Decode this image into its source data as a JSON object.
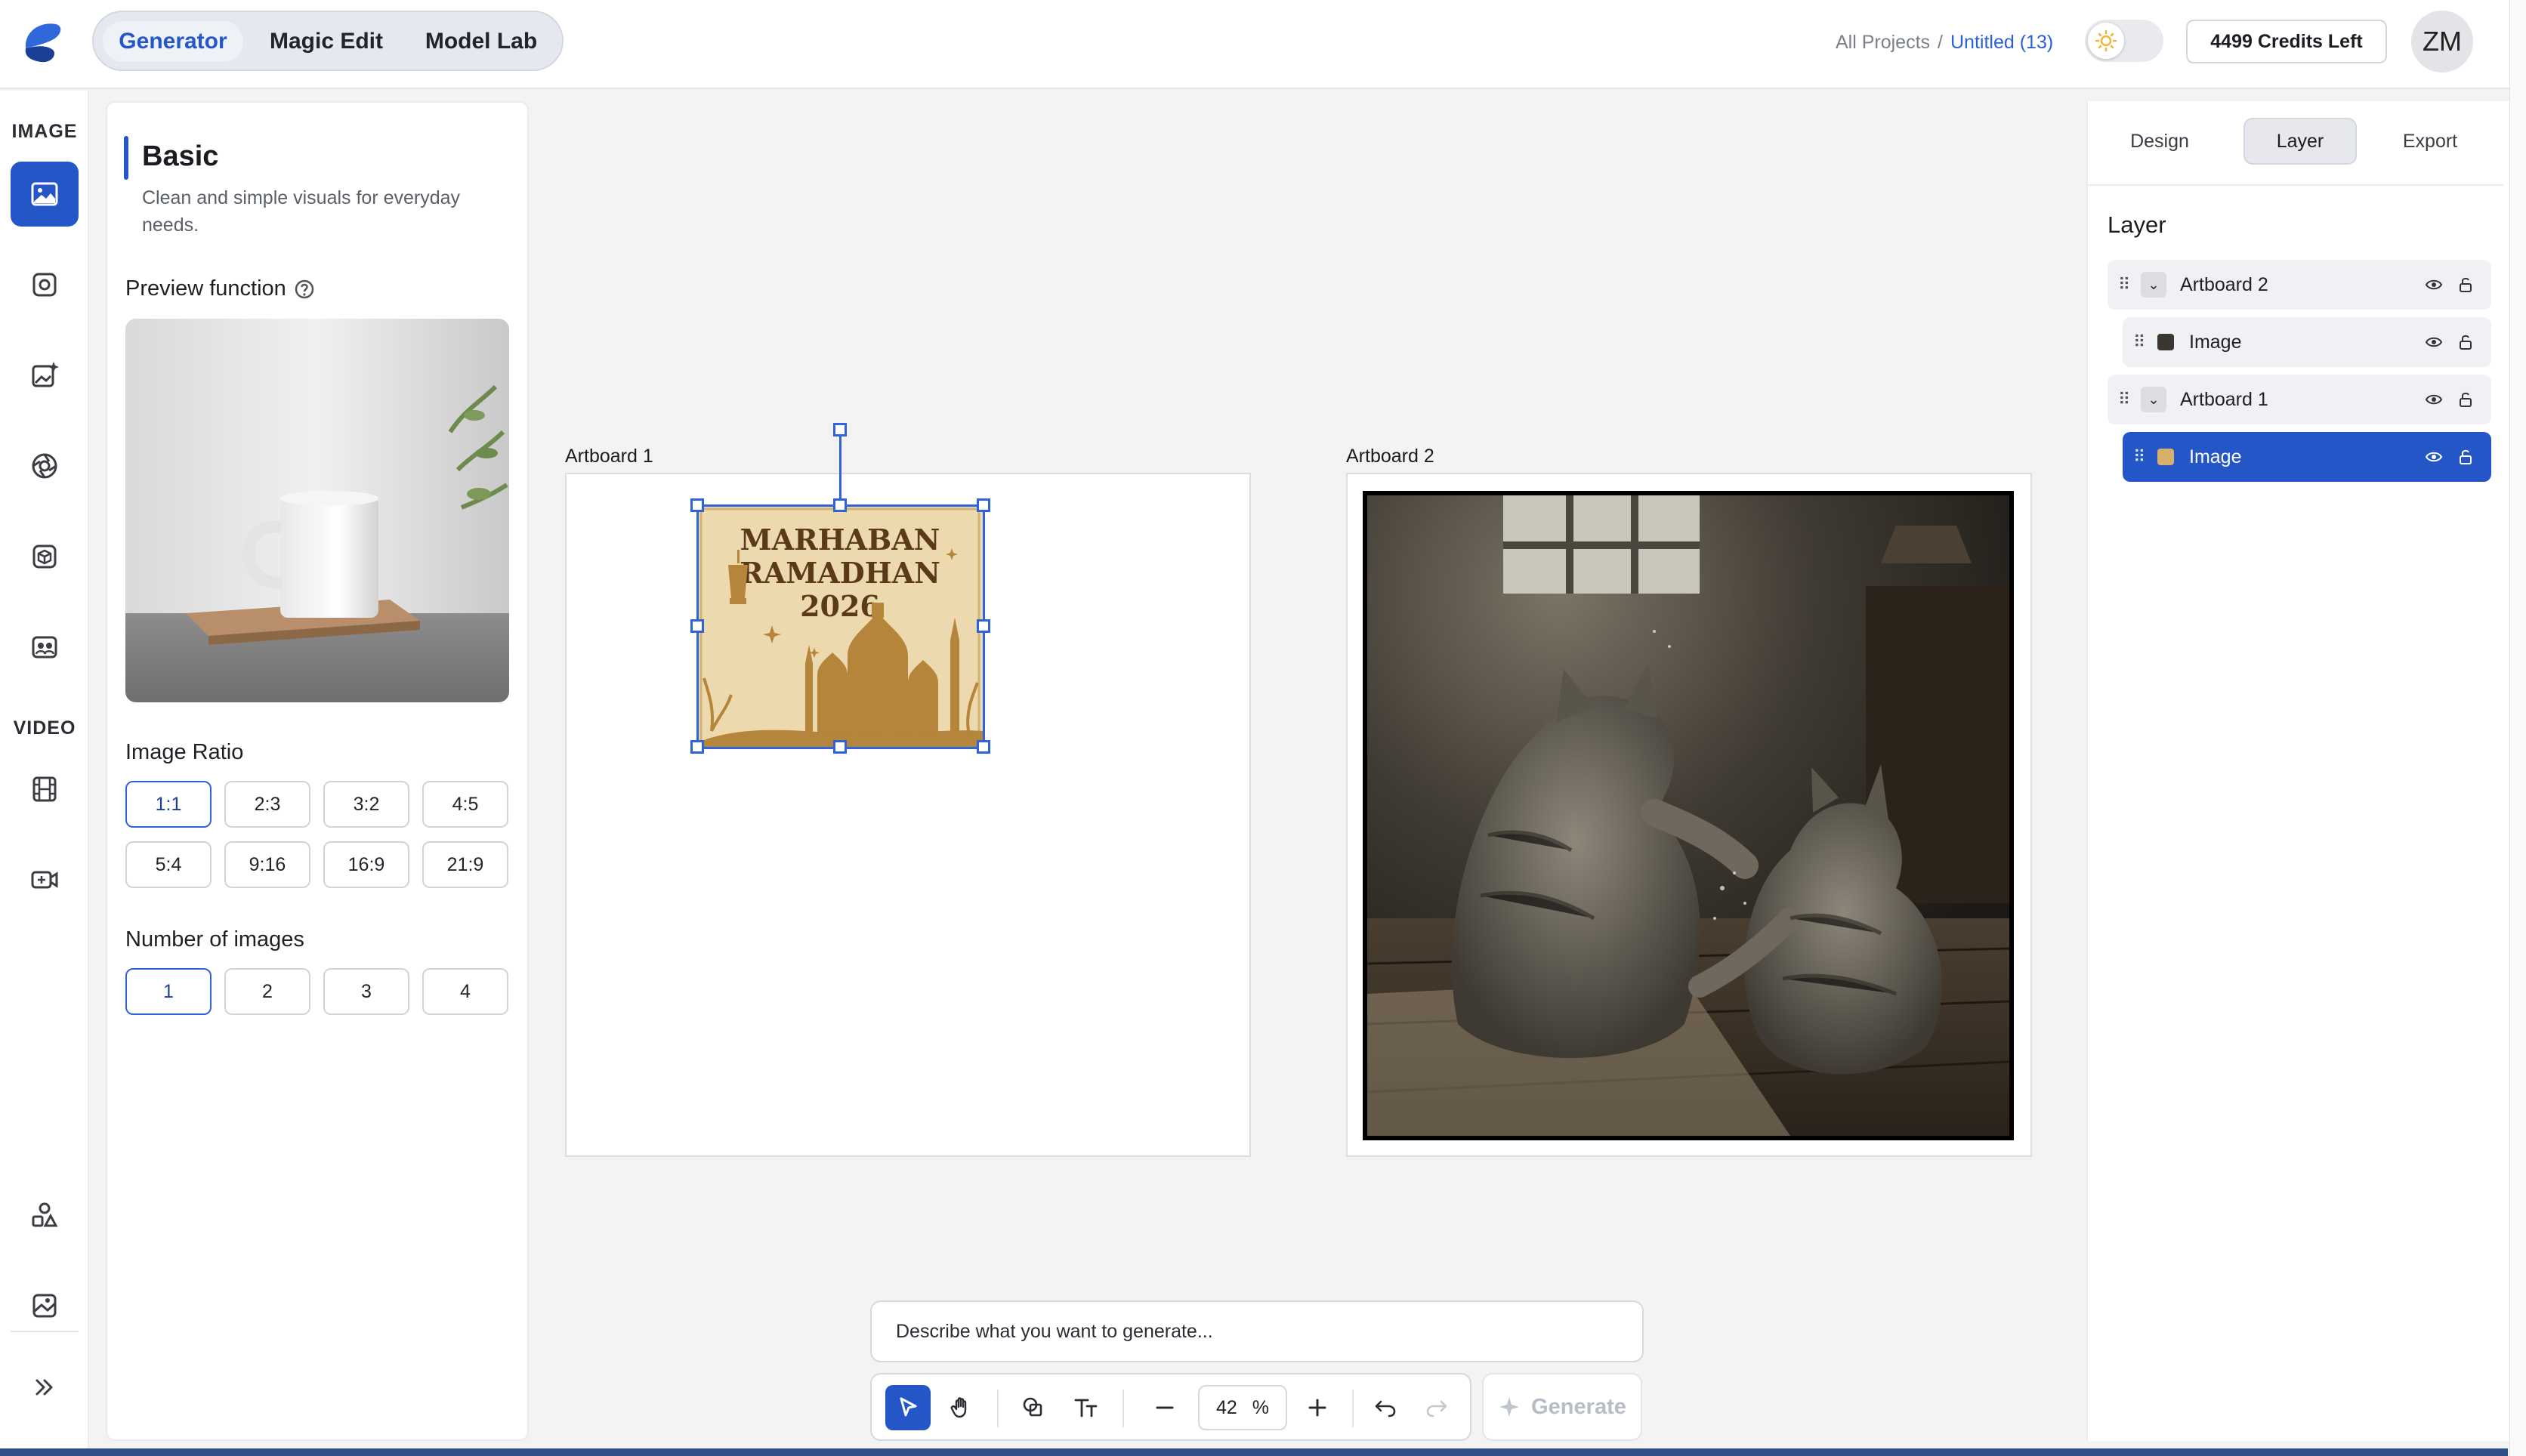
{
  "header": {
    "modes": [
      "Generator",
      "Magic Edit",
      "Model Lab"
    ],
    "active_mode": "Generator",
    "breadcrumb": {
      "root": "All Projects",
      "separator": "/",
      "current": "Untitled (13)"
    },
    "credits": "4499 Credits Left",
    "avatar_initials": "ZM"
  },
  "rail": {
    "image_heading": "IMAGE",
    "video_heading": "VIDEO",
    "image_tools": [
      "image-icon",
      "camera-icon",
      "magic-image-icon",
      "aperture-icon",
      "box-icon",
      "photo-group-icon"
    ],
    "video_tools": [
      "film-icon",
      "video-camera-icon"
    ],
    "bottom_tools": [
      "shapes-icon",
      "gallery-icon",
      "expand-icon"
    ]
  },
  "panel": {
    "title": "Basic",
    "description": "Clean and simple visuals for everyday needs.",
    "preview_label": "Preview function",
    "ratio_label": "Image Ratio",
    "ratios": [
      "1:1",
      "2:3",
      "3:2",
      "4:5",
      "5:4",
      "9:16",
      "16:9",
      "21:9"
    ],
    "selected_ratio": "1:1",
    "count_label": "Number of images",
    "counts": [
      "1",
      "2",
      "3",
      "4"
    ],
    "selected_count": "1"
  },
  "canvas": {
    "artboard1": {
      "label": "Artboard 1",
      "image_text": [
        "MARHABAN",
        "RAMADHAN",
        "2026"
      ]
    },
    "artboard2": {
      "label": "Artboard 2"
    }
  },
  "right_panel": {
    "tabs": [
      "Design",
      "Layer",
      "Export"
    ],
    "active_tab": "Layer",
    "heading": "Layer",
    "layers": [
      {
        "name": "Artboard 2",
        "kind": "artboard"
      },
      {
        "name": "Image",
        "kind": "image"
      },
      {
        "name": "Artboard 1",
        "kind": "artboard"
      },
      {
        "name": "Image",
        "kind": "image",
        "selected": true
      }
    ]
  },
  "bottom": {
    "prompt_placeholder": "Describe what you want to generate...",
    "zoom_value": "42",
    "zoom_unit": "%",
    "generate_label": "Generate"
  },
  "colors": {
    "accent": "#2456c7",
    "canvas_bg": "#f3f3f4"
  }
}
